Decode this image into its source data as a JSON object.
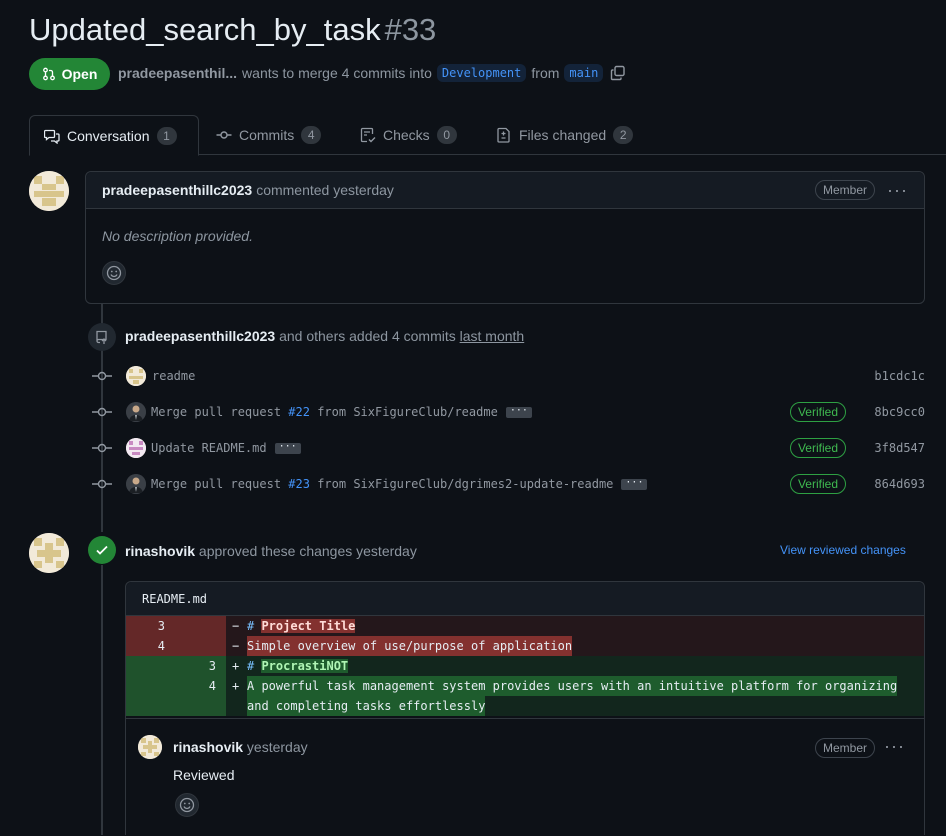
{
  "pr": {
    "title": "Updated_search_by_task",
    "number": "#33",
    "state": "Open",
    "author": "pradeepasenthil...",
    "merge_text": "wants to merge 4 commits into",
    "base_branch": "Development",
    "from_text": "from",
    "head_branch": "main"
  },
  "tabs": [
    {
      "label": "Conversation",
      "count": "1"
    },
    {
      "label": "Commits",
      "count": "4"
    },
    {
      "label": "Checks",
      "count": "0"
    },
    {
      "label": "Files changed",
      "count": "2"
    }
  ],
  "first_comment": {
    "author": "pradeepasenthillc2023",
    "action": "commented yesterday",
    "role": "Member",
    "body": "No description provided."
  },
  "commits_event": {
    "author": "pradeepasenthillc2023",
    "text": "and others added 4 commits",
    "time": "last month",
    "commits": [
      {
        "pre": "readme",
        "link": "",
        "post": "",
        "verified": "",
        "sha": "b1cdc1c"
      },
      {
        "pre": "Merge pull request ",
        "link": "#22",
        "post": " from SixFigureClub/readme",
        "verified": "Verified",
        "sha": "8bc9cc0"
      },
      {
        "pre": "Update README.md",
        "link": "",
        "post": "",
        "verified": "Verified",
        "sha": "3f8d547"
      },
      {
        "pre": "Merge pull request ",
        "link": "#23",
        "post": " from SixFigureClub/dgrimes2-update-readme",
        "verified": "Verified",
        "sha": "864d693"
      }
    ]
  },
  "review": {
    "author": "rinashovik",
    "text": "approved these changes yesterday",
    "view_link": "View reviewed changes",
    "file": "README.md",
    "diff": [
      {
        "type": "del",
        "old": "3",
        "new": "",
        "sign": "−",
        "prefix": "# ",
        "content": "Project Title"
      },
      {
        "type": "del",
        "old": "4",
        "new": "",
        "sign": "−",
        "prefix": "",
        "content": "Simple overview of use/purpose of application"
      },
      {
        "type": "add",
        "old": "",
        "new": "3",
        "sign": "+",
        "prefix": "# ",
        "content": "ProcrastiNOT"
      },
      {
        "type": "add",
        "old": "",
        "new": "4",
        "sign": "+",
        "prefix": "",
        "content": "A powerful task management system provides users with an intuitive platform for organizing "
      },
      {
        "type": "add",
        "old": "",
        "new": "",
        "sign": "",
        "prefix": "",
        "content": "and completing tasks effortlessly"
      }
    ],
    "comment": {
      "author": "rinashovik",
      "time": "yesterday",
      "role": "Member",
      "body": "Reviewed"
    }
  },
  "colors": {
    "background": "#0d1117",
    "open_green": "#238636",
    "link_blue": "#4493f8",
    "verified_green": "#3fb950"
  }
}
